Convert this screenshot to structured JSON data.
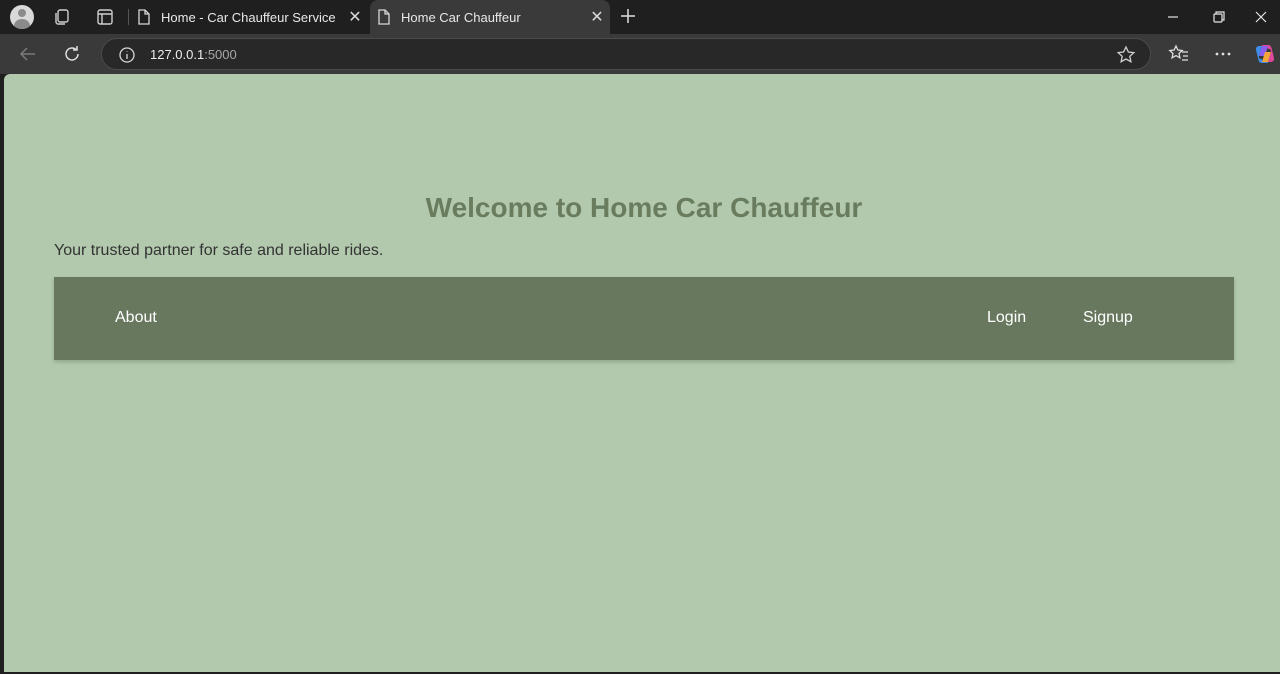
{
  "browser": {
    "tabs": [
      {
        "title": "Home - Car Chauffeur Service"
      },
      {
        "title": "Home Car Chauffeur"
      }
    ],
    "address": {
      "host": "127.0.0.1",
      "port": ":5000"
    }
  },
  "page": {
    "heading": "Welcome to Home Car Chauffeur",
    "tagline": "Your trusted partner for safe and reliable rides.",
    "nav": {
      "about": "About",
      "login": "Login",
      "signup": "Signup"
    }
  },
  "colors": {
    "page_background": "#b2c9ad",
    "navbar": "#68785e",
    "heading": "#6a7c5e"
  }
}
